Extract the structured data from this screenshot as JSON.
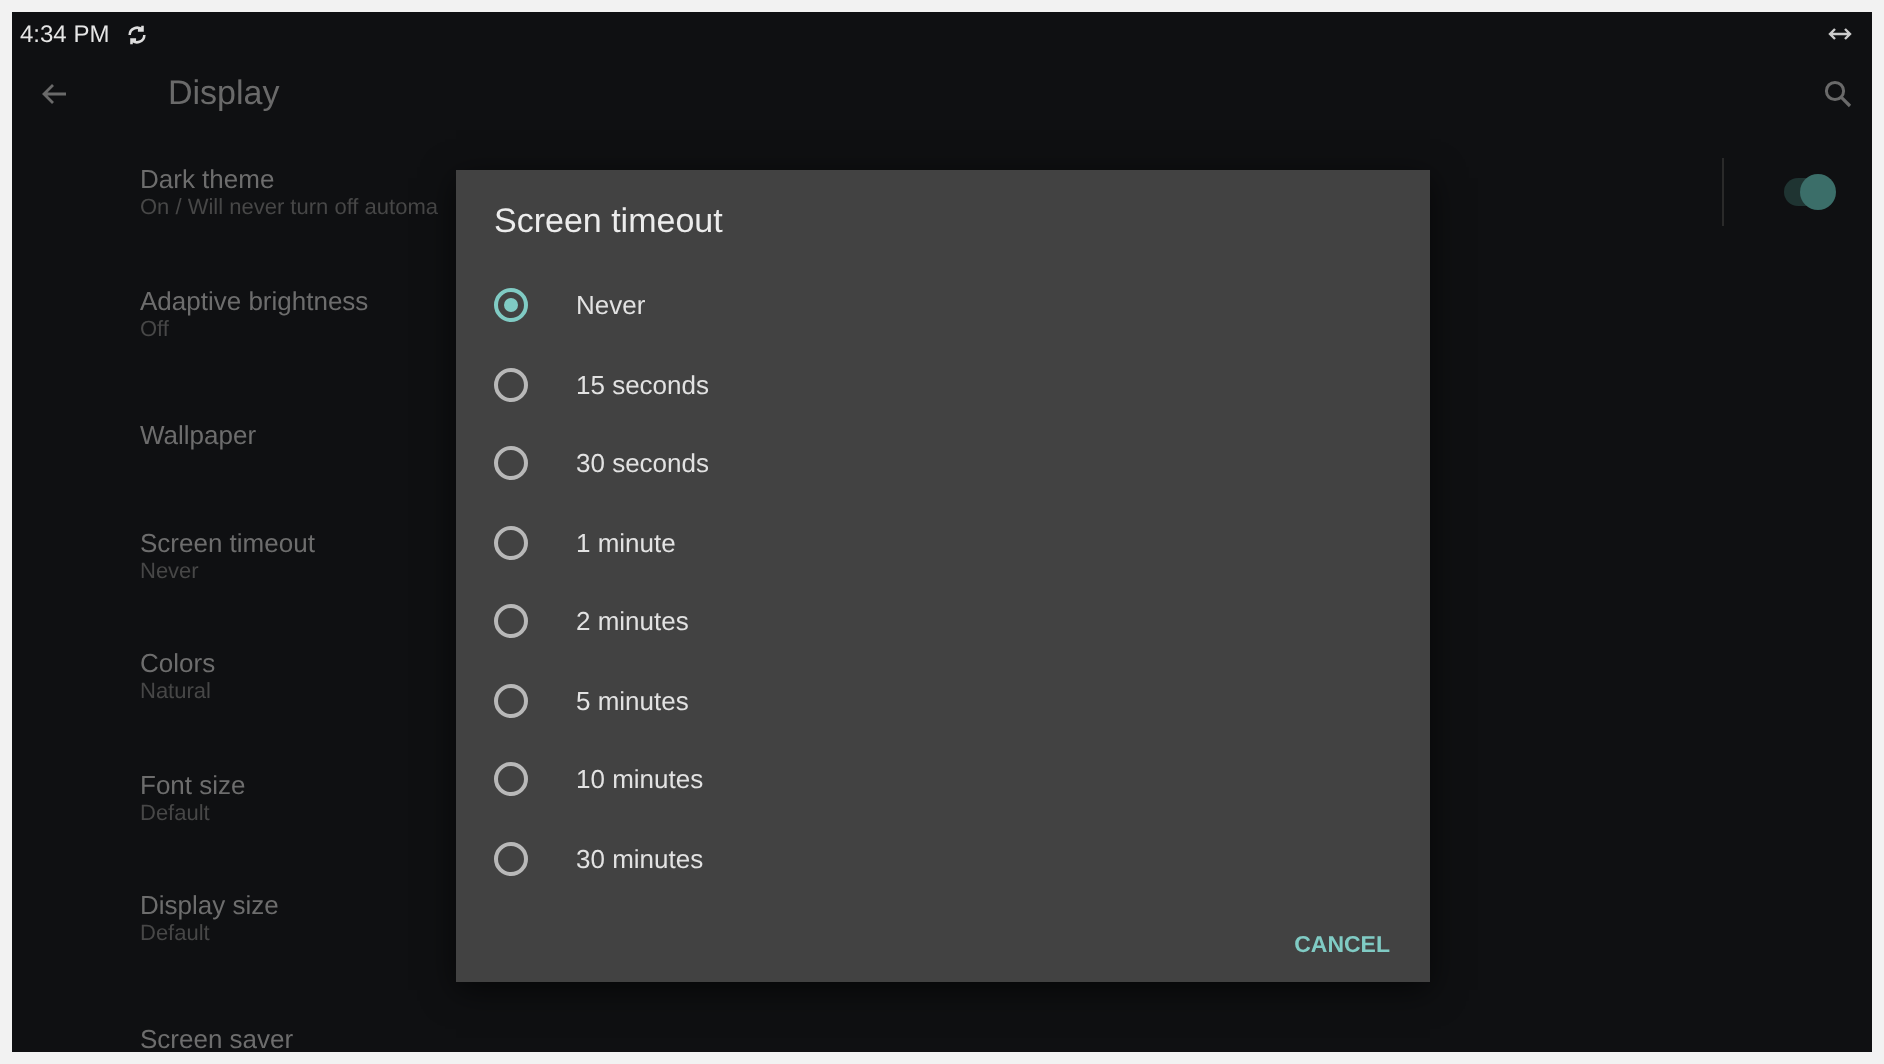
{
  "status_bar": {
    "time": "4:34 PM"
  },
  "toolbar": {
    "title": "Display"
  },
  "settings": [
    {
      "title": "Dark theme",
      "summary": "On / Will never turn off automa",
      "toggle": {
        "on": true
      }
    },
    {
      "title": "Adaptive brightness",
      "summary": "Off"
    },
    {
      "title": "Wallpaper"
    },
    {
      "title": "Screen timeout",
      "summary": "Never"
    },
    {
      "title": "Colors",
      "summary": "Natural"
    },
    {
      "title": "Font size",
      "summary": "Default"
    },
    {
      "title": "Display size",
      "summary": "Default"
    },
    {
      "title": "Screen saver"
    }
  ],
  "dialog": {
    "title": "Screen timeout",
    "options": [
      {
        "label": "Never",
        "selected": true
      },
      {
        "label": "15 seconds",
        "selected": false
      },
      {
        "label": "30 seconds",
        "selected": false
      },
      {
        "label": "1 minute",
        "selected": false
      },
      {
        "label": "2 minutes",
        "selected": false
      },
      {
        "label": "5 minutes",
        "selected": false
      },
      {
        "label": "10 minutes",
        "selected": false
      },
      {
        "label": "30 minutes",
        "selected": false
      }
    ],
    "buttons": [
      "CANCEL"
    ]
  }
}
